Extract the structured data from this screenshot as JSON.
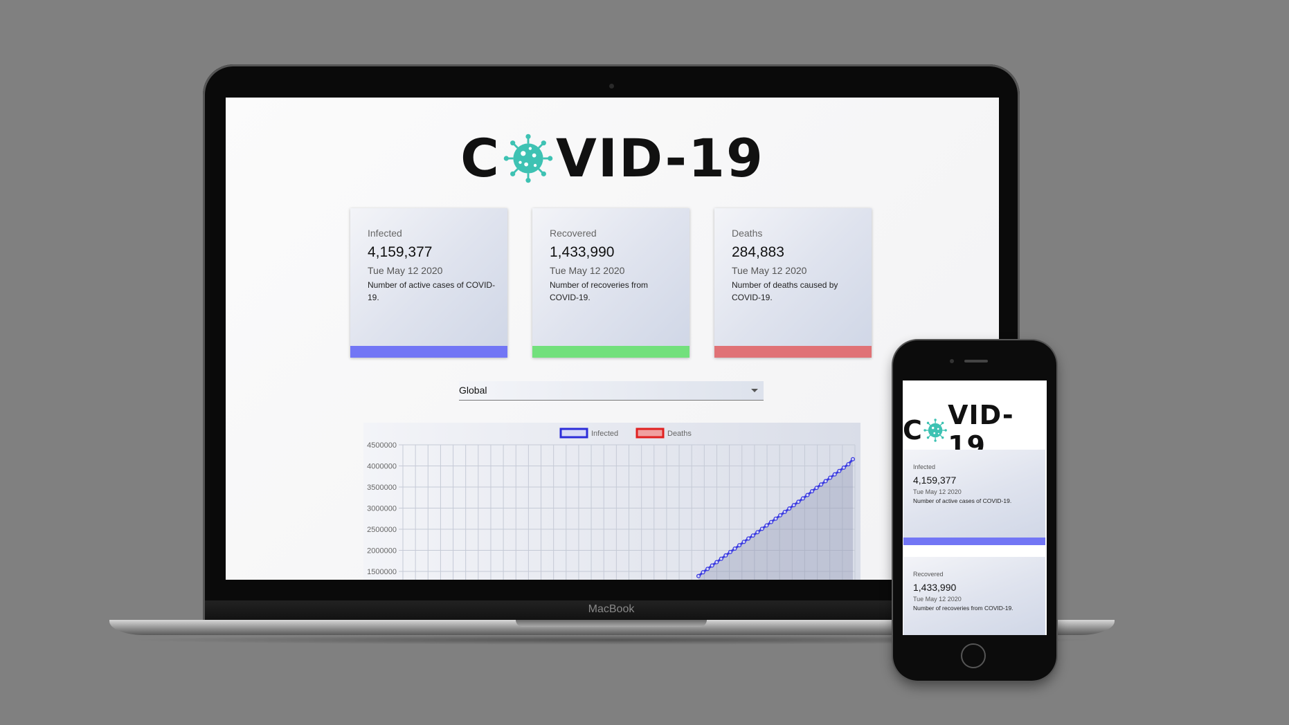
{
  "device": {
    "laptop_brand": "MacBook"
  },
  "logo": {
    "prefix": "C",
    "suffix": "VID-19"
  },
  "colors": {
    "infected": "#7276f5",
    "recovered": "#72e07c",
    "deaths": "#e07276",
    "virus": "#3ec2b3"
  },
  "cards": [
    {
      "label": "Infected",
      "value": "4,159,377",
      "date": "Tue May 12 2020",
      "description": "Number of active cases of COVID-19."
    },
    {
      "label": "Recovered",
      "value": "1,433,990",
      "date": "Tue May 12 2020",
      "description": "Number of recoveries from COVID-19."
    },
    {
      "label": "Deaths",
      "value": "284,883",
      "date": "Tue May 12 2020",
      "description": "Number of deaths caused by COVID-19."
    }
  ],
  "country_select": {
    "selected": "Global"
  },
  "chart_data": {
    "type": "line",
    "legend": [
      "Infected",
      "Deaths"
    ],
    "legend_position": "top",
    "grid": true,
    "y_ticks": [
      4500000,
      4000000,
      3500000,
      3000000,
      2500000,
      2000000,
      1500000
    ],
    "ylim": [
      1500000,
      4500000
    ],
    "series": [
      {
        "name": "Infected",
        "values": [
          1390000,
          1480000,
          1560000,
          1640000,
          1720000,
          1800000,
          1880000,
          1960000,
          2040000,
          2120000,
          2200000,
          2280000,
          2350000,
          2430000,
          2510000,
          2590000,
          2670000,
          2750000,
          2830000,
          2910000,
          2990000,
          3070000,
          3150000,
          3230000,
          3310000,
          3400000,
          3480000,
          3560000,
          3640000,
          3720000,
          3800000,
          3880000,
          3960000,
          4040000,
          4159377
        ]
      }
    ]
  }
}
